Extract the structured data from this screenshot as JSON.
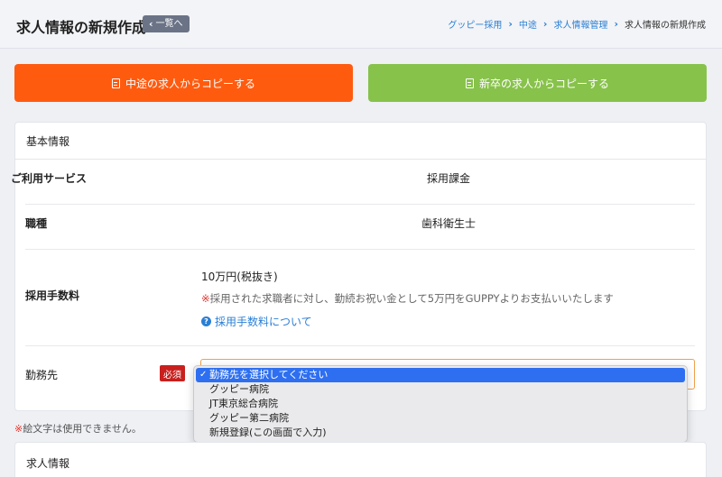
{
  "header": {
    "title": "求人情報の新規作成",
    "back_label": "一覧へ",
    "breadcrumb": [
      "グッピー採用",
      "中途",
      "求人情報管理",
      "求人情報の新規作成"
    ]
  },
  "copy_buttons": {
    "midcareer": "中途の求人からコピーする",
    "newgrad": "新卒の求人からコピーする"
  },
  "colors": {
    "midcareer_button": "#ff5b0f",
    "newgrad_button": "#87c24a",
    "link": "#2a7fd4",
    "required": "#c8201e"
  },
  "basic_info": {
    "title": "基本情報",
    "service_label": "ご利用サービス",
    "service_value": "採用課金",
    "occupation_label": "職種",
    "occupation_value": "歯科衛生士",
    "fee_label": "採用手数料",
    "fee_value": "10万円(税抜き)",
    "fee_note_mark": "※",
    "fee_note": "採用された求職者に対し、勤続お祝い金として5万円をGUPPYよりお支払いいたします",
    "fee_link": "採用手数料について",
    "workplace_label": "勤務先",
    "required_badge": "必須"
  },
  "workplace_select": {
    "options": [
      "勤務先を選択してください",
      "グッピー病院",
      "JT東京総合病院",
      "グッピー第二病院",
      "新規登録(この画面で入力)"
    ],
    "selected_index": 0
  },
  "emoji_note": {
    "mark": "※",
    "text": "絵文字は使用できません。"
  },
  "job_info": {
    "title": "求人情報"
  },
  "icons": [
    "chevron-left-icon",
    "chevron-right-icon",
    "document-icon",
    "question-icon",
    "check-icon"
  ]
}
